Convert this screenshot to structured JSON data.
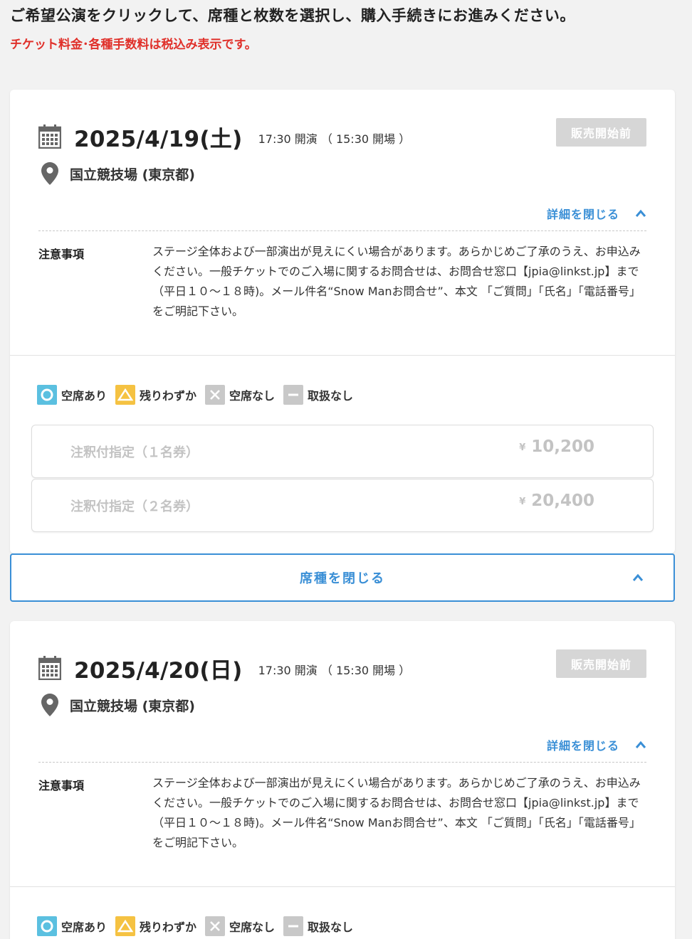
{
  "intro": {
    "main": "ご希望公演をクリックして、席種と枚数を選択し、購入手続きにお進みください。",
    "note": "チケット料金･各種手数料は税込み表示です。"
  },
  "colors": {
    "accent": "#3a8fd6",
    "warning": "#e0302a",
    "available": "#5bc0e0",
    "few": "#f5c242",
    "disabled": "#c8c8c8"
  },
  "legend": [
    {
      "icon": "circle-icon",
      "label": "空席あり"
    },
    {
      "icon": "triangle-icon",
      "label": "残りわずか"
    },
    {
      "icon": "cross-icon",
      "label": "空席なし"
    },
    {
      "icon": "dash-icon",
      "label": "取扱なし"
    }
  ],
  "performances": [
    {
      "date": "2025/4/19(土)",
      "time": "17:30 開演 （ 15:30 開場 ）",
      "status": "販売開始前",
      "venue": "国立競技場 (東京都)",
      "detail_toggle": "詳細を閉じる",
      "notes_label": "注意事項",
      "notes": "ステージ全体および一部演出が見えにくい場合があります。あらかじめご了承のうえ、お申込みください。一般チケットでのご入場に関するお問合せは、お問合せ窓口【jpia@linkst.jp】まで（平日１０～１８時)。メール件名“Snow Manお問合せ”、本文 「ご質問」「氏名」「電話番号」 をご明記下さい。",
      "seats": [
        {
          "name": "注釈付指定（１名券）",
          "currency": "¥",
          "price": "10,200"
        },
        {
          "name": "注釈付指定（２名券）",
          "currency": "¥",
          "price": "20,400"
        }
      ],
      "close_seats": "席種を閉じる"
    },
    {
      "date": "2025/4/20(日)",
      "time": "17:30 開演 （ 15:30 開場 ）",
      "status": "販売開始前",
      "venue": "国立競技場 (東京都)",
      "detail_toggle": "詳細を閉じる",
      "notes_label": "注意事項",
      "notes": "ステージ全体および一部演出が見えにくい場合があります。あらかじめご了承のうえ、お申込みください。一般チケットでのご入場に関するお問合せは、お問合せ窓口【jpia@linkst.jp】まで（平日１０～１８時)。メール件名“Snow Manお問合せ”、本文 「ご質問」「氏名」「電話番号」 をご明記下さい。"
    }
  ]
}
